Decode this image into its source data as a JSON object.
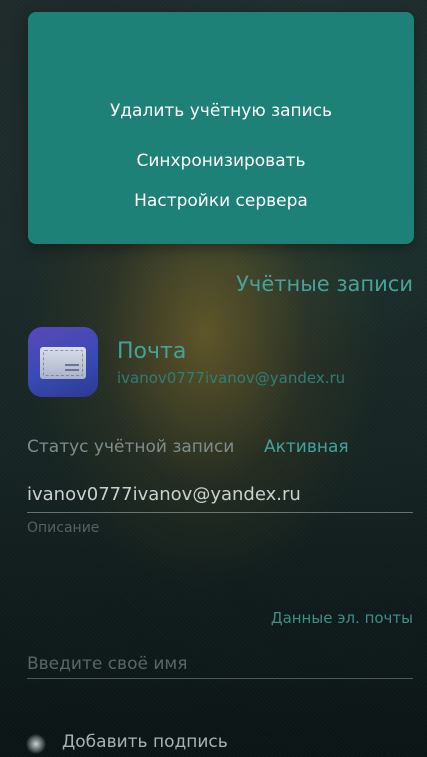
{
  "menu": {
    "items": [
      {
        "label": "Удалить учётную запись"
      },
      {
        "label": "Синхронизировать"
      },
      {
        "label": "Настройки сервера"
      }
    ]
  },
  "page": {
    "title": "Учётные записи"
  },
  "account": {
    "app_name": "Почта",
    "email": "ivanov0777ivanov@yandex.ru",
    "icon": "mail-envelope-icon"
  },
  "status": {
    "label": "Статус учётной записи",
    "value": "Активная"
  },
  "account_field": {
    "value": "ivanov0777ivanov@yandex.ru",
    "caption": "Описание"
  },
  "email_section": {
    "label": "Данные эл. почты",
    "name_placeholder": "Введите своё имя",
    "name_value": ""
  },
  "signature": {
    "label": "Добавить подпись",
    "enabled": false
  },
  "colors": {
    "accent": "#44a399",
    "menu_bg": "#1d8178"
  }
}
